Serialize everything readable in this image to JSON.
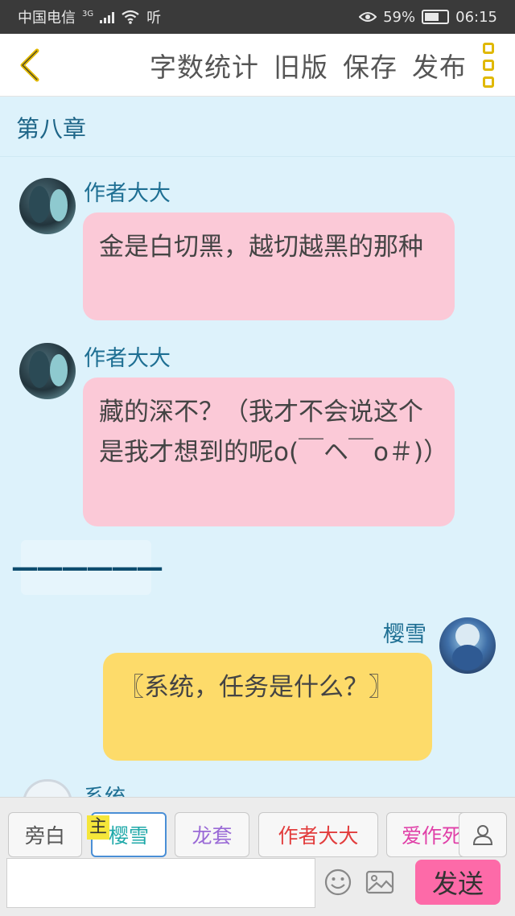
{
  "status_bar": {
    "carrier": "中国电信",
    "network": "3G",
    "hd": "听",
    "battery": "59%",
    "time": "06:15"
  },
  "toolbar": {
    "word_count": "字数统计",
    "old_version": "旧版",
    "save": "保存",
    "publish": "发布"
  },
  "chapter_title": "第八章",
  "messages": [
    {
      "name": "作者大大",
      "text": "金是白切黑，越切越黑的那种",
      "color": "#fbc9d7"
    },
    {
      "name": "作者大大",
      "text": "藏的深不？（我才不会说这个是我才想到的呢o(￣ヘ￣o＃)）",
      "color": "#fbc9d7"
    },
    {
      "separator": "——————"
    },
    {
      "name": "樱雪",
      "text": "〖系统，任务是什么？〗",
      "color": "#fddb6a"
    },
    {
      "name": "系统"
    }
  ],
  "role_chips": [
    {
      "label": "旁白",
      "color": "#555555"
    },
    {
      "label": "樱雪",
      "color": "#1fa9a9",
      "badge": "主",
      "selected": true
    },
    {
      "label": "龙套",
      "color": "#9a6ad6"
    },
    {
      "label": "作者大大",
      "color": "#e23d3d"
    },
    {
      "label": "爱作死",
      "color": "#e040a8"
    }
  ],
  "compose": {
    "placeholder": "",
    "send_label": "发送"
  },
  "icons": {
    "back": "chevron-left-icon",
    "menu": "more-vertical-icon",
    "user": "user-icon",
    "emoji": "emoji-icon",
    "image": "image-icon"
  },
  "colors": {
    "accent": "#e0b800",
    "name": "#1e6f93",
    "send": "#fd6aa8",
    "background": "#ddf2fb"
  }
}
